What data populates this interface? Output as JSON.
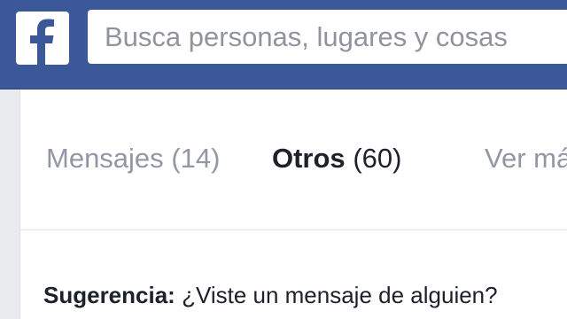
{
  "header": {
    "logo_icon": "facebook-f-icon",
    "search_placeholder": "Busca personas, lugares y cosas",
    "brand_color": "#3b5998"
  },
  "tabs": {
    "inbox": {
      "label": "Mensajes",
      "count": "(14)"
    },
    "other": {
      "label": "Otros",
      "count": "(60)"
    },
    "more": {
      "label": "Ver más"
    }
  },
  "tip": {
    "label": "Sugerencia:",
    "text": "¿Viste un mensaje de alguien?"
  }
}
